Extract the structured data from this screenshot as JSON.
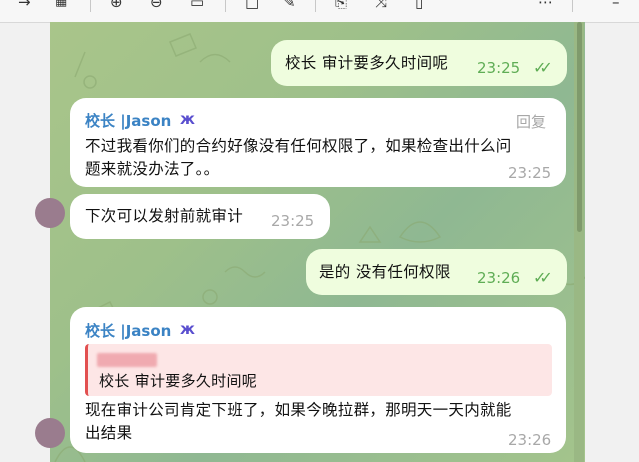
{
  "toolbar": {
    "icons": [
      "arrow-right-icon",
      "grid-icon",
      "zoom-in-icon",
      "zoom-out-icon",
      "calendar-icon",
      "square-icon",
      "edit-icon",
      "export-icon",
      "shuffle-icon",
      "document-icon",
      "more-icon",
      "minimize-icon"
    ]
  },
  "messages": {
    "m1": {
      "text": "校长 审计要多久时间呢",
      "time": "23:25"
    },
    "m2": {
      "sender": "校长 |Jason",
      "badge": "🦋",
      "reply_label": "回复",
      "line1": "不过我看你们的合约好像没有任何权限了，如果检查出什么问",
      "line2": "题来就没办法了。。",
      "time": "23:25"
    },
    "m3": {
      "text": "下次可以发射前就审计",
      "time": "23:25"
    },
    "m4": {
      "text": "是的 没有任何权限",
      "time": "23:26"
    },
    "m5": {
      "sender": "校长 |Jason",
      "badge": "🦋",
      "quote_text": "校长 审计要多久时间呢",
      "line1": "现在审计公司肯定下班了，如果今晚拉群，那明天一天内就能",
      "line2": "出结果",
      "time": "23:26"
    }
  },
  "colors": {
    "outgoing_bubble": "#effdde",
    "incoming_bubble": "#ffffff",
    "sender_name": "#3b83c4",
    "read_check": "#5fad55",
    "quote_accent": "#e25050"
  }
}
